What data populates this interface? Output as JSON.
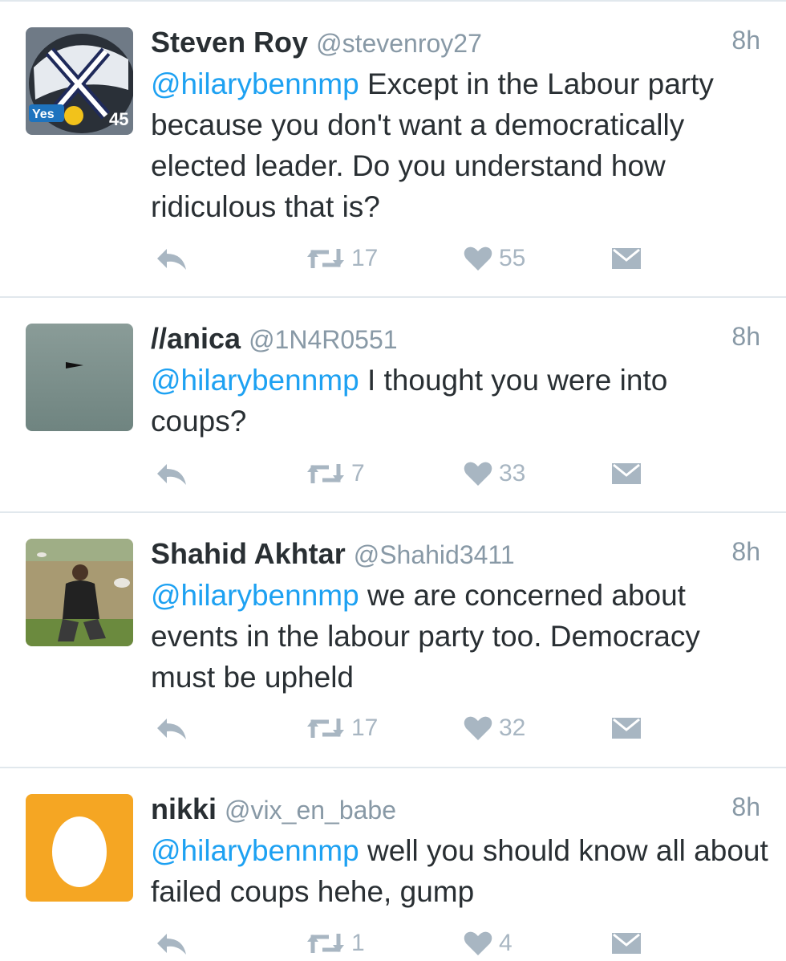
{
  "colors": {
    "mention": "#1da1f2",
    "name": "#292f33",
    "meta": "#8899a6",
    "action_icon": "#a8b6c2",
    "divider": "#e1e8ed"
  },
  "tweets": [
    {
      "name": "Steven Roy",
      "handle": "@stevenroy27",
      "time": "8h",
      "mention": "@hilarybennmp",
      "text": " Except in the Labour party because you don't want a democratically elected leader. Do you understand how ridiculous that is?",
      "retweets": "17",
      "likes": "55",
      "avatar": {
        "type": "helmet",
        "badge_text": "Yes",
        "number": "45"
      }
    },
    {
      "name": "//anica",
      "handle": "@1N4R0551",
      "time": "8h",
      "mention": "@hilarybennmp",
      "text": " I thought you were into coups?",
      "retweets": "7",
      "likes": "33",
      "avatar": {
        "type": "sky-bird"
      }
    },
    {
      "name": "Shahid Akhtar",
      "handle": "@Shahid3411",
      "time": "8h",
      "mention": "@hilarybennmp",
      "text": " we are concerned about events in the labour party too. Democracy must be upheld",
      "retweets": "17",
      "likes": "32",
      "avatar": {
        "type": "hiker-photo"
      }
    },
    {
      "name": "nikki",
      "handle": "@vix_en_babe",
      "time": "8h",
      "mention": "@hilarybennmp",
      "text": " well you should know all about failed coups hehe, gump",
      "retweets": "1",
      "likes": "4",
      "avatar": {
        "type": "default-egg"
      }
    }
  ]
}
